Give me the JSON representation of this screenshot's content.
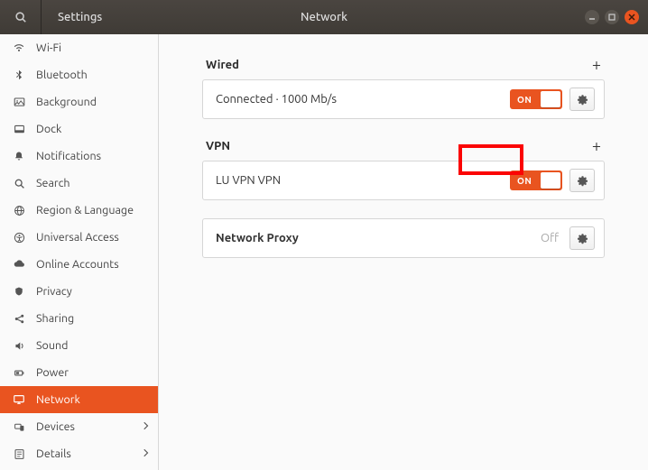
{
  "header": {
    "app_title": "Settings",
    "page_title": "Network"
  },
  "sidebar": {
    "items": [
      {
        "label": "Wi-Fi",
        "icon": "wifi"
      },
      {
        "label": "Bluetooth",
        "icon": "bluetooth"
      },
      {
        "label": "Background",
        "icon": "background"
      },
      {
        "label": "Dock",
        "icon": "dock"
      },
      {
        "label": "Notifications",
        "icon": "bell"
      },
      {
        "label": "Search",
        "icon": "search"
      },
      {
        "label": "Region & Language",
        "icon": "globe"
      },
      {
        "label": "Universal Access",
        "icon": "universal"
      },
      {
        "label": "Online Accounts",
        "icon": "cloud"
      },
      {
        "label": "Privacy",
        "icon": "privacy"
      },
      {
        "label": "Sharing",
        "icon": "share"
      },
      {
        "label": "Sound",
        "icon": "sound"
      },
      {
        "label": "Power",
        "icon": "power"
      },
      {
        "label": "Network",
        "icon": "network",
        "active": true
      },
      {
        "label": "Devices",
        "icon": "devices",
        "chevron": true
      },
      {
        "label": "Details",
        "icon": "details",
        "chevron": true
      }
    ]
  },
  "wired": {
    "section_title": "Wired",
    "status": "Connected · 1000 Mb/s",
    "toggle_label": "ON"
  },
  "vpn": {
    "section_title": "VPN",
    "name": "LU VPN VPN",
    "toggle_label": "ON"
  },
  "proxy": {
    "label": "Network Proxy",
    "status": "Off"
  }
}
